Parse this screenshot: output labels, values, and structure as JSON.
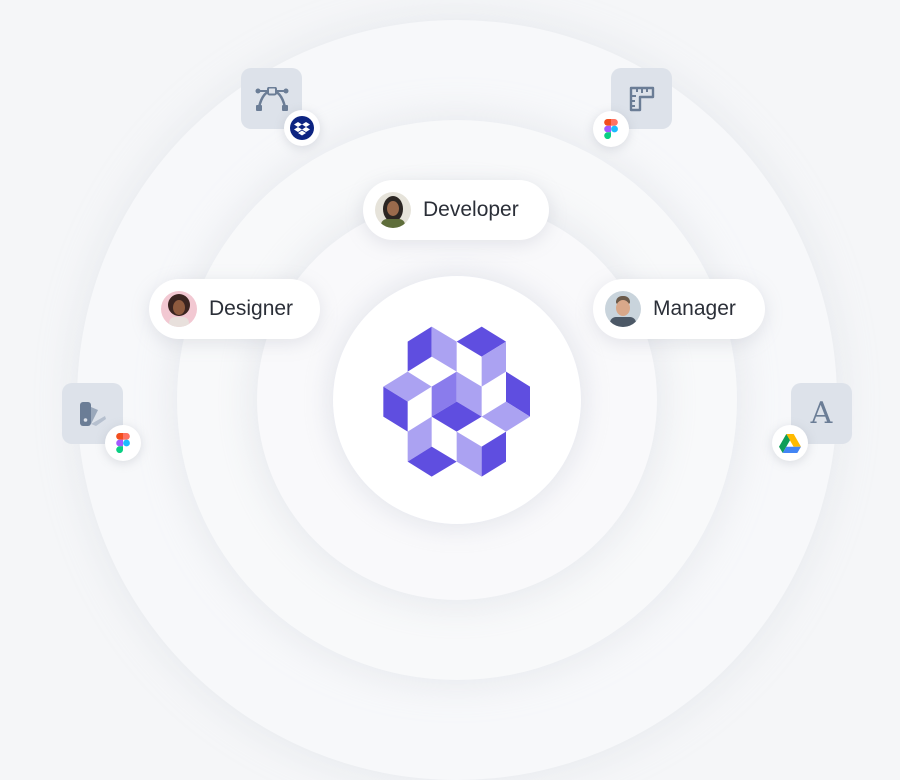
{
  "roles": [
    {
      "label": "Developer",
      "avatar": "developer-avatar"
    },
    {
      "label": "Designer",
      "avatar": "designer-avatar"
    },
    {
      "label": "Manager",
      "avatar": "manager-avatar"
    }
  ],
  "tools": [
    {
      "icon": "bezier-pen-icon",
      "badge": "dropbox-icon"
    },
    {
      "icon": "ruler-icon",
      "badge": "figma-icon"
    },
    {
      "icon": "swatch-icon",
      "badge": "figma-icon"
    },
    {
      "icon": "typography-icon",
      "badge": "google-drive-icon",
      "glyph": "A"
    }
  ],
  "colors": {
    "brand_dark": "#5f4ee0",
    "brand_mid": "#8a7cec",
    "brand_light": "#aba2f2",
    "tile": "#dde2ea",
    "icon": "#6b7d96"
  }
}
